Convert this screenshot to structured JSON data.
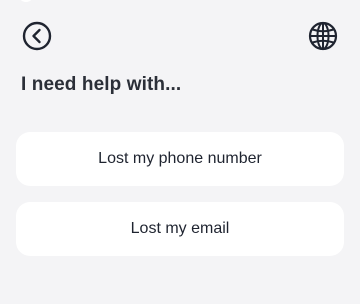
{
  "header": {
    "back_icon": "chevron-left-circle-icon",
    "language_icon": "globe-icon"
  },
  "main": {
    "title": "I need help with...",
    "options": [
      {
        "label": "Lost my phone number"
      },
      {
        "label": "Lost my email"
      }
    ]
  },
  "colors": {
    "background": "#f4f4f6",
    "card": "#ffffff",
    "text": "#1f2430"
  }
}
